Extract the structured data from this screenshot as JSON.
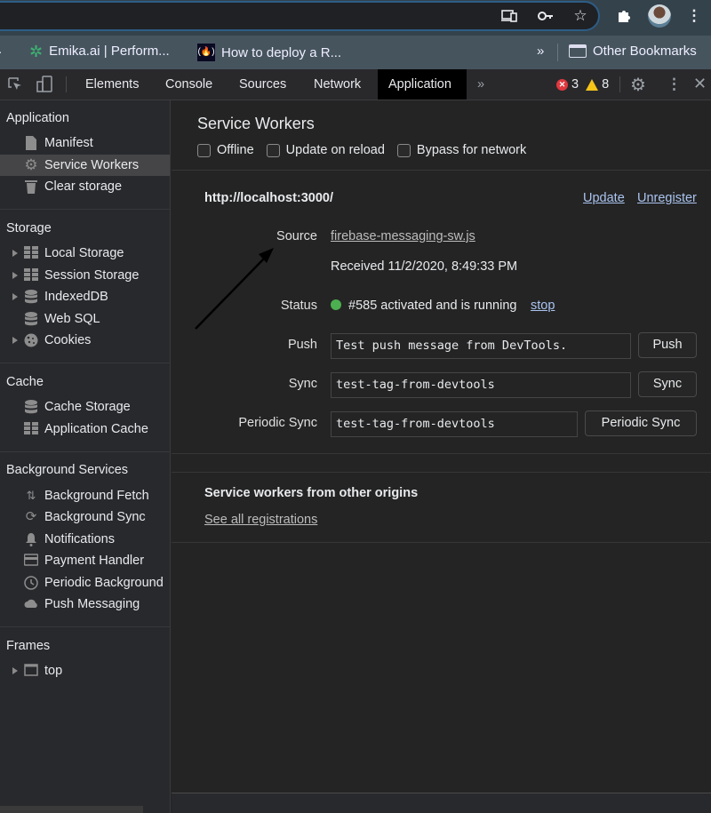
{
  "browser": {
    "toolbar_icons": [
      "cast-device-icon",
      "key-icon",
      "star-icon",
      "extensions-icon",
      "avatar",
      "more-icon"
    ],
    "bookmarks": [
      {
        "label": "Emika.ai | Perform...",
        "icon": "emika-logo-icon"
      },
      {
        "label": "How to deploy a R...",
        "icon": "freecodecamp-logo-icon"
      }
    ],
    "overflow_label": "»",
    "other_bookmarks": "Other Bookmarks"
  },
  "devtools": {
    "tabs": [
      "Elements",
      "Console",
      "Sources",
      "Network",
      "Application"
    ],
    "active_tab": "Application",
    "more_tabs": "»",
    "error_count": "3",
    "warning_count": "8",
    "colors": {
      "error": "#e0383e",
      "warning": "#f5c518",
      "status_ok": "#4caf50",
      "link": "#aac4ef"
    }
  },
  "sidebar": {
    "sections": [
      {
        "title": "Application",
        "items": [
          {
            "label": "Manifest",
            "icon": "file-icon",
            "expandable": false
          },
          {
            "label": "Service Workers",
            "icon": "gear-icon",
            "expandable": false,
            "selected": true
          },
          {
            "label": "Clear storage",
            "icon": "trash-icon",
            "expandable": false
          }
        ]
      },
      {
        "title": "Storage",
        "items": [
          {
            "label": "Local Storage",
            "icon": "grid-icon",
            "expandable": true
          },
          {
            "label": "Session Storage",
            "icon": "grid-icon",
            "expandable": true
          },
          {
            "label": "IndexedDB",
            "icon": "database-icon",
            "expandable": true
          },
          {
            "label": "Web SQL",
            "icon": "database-icon",
            "expandable": false
          },
          {
            "label": "Cookies",
            "icon": "cookie-icon",
            "expandable": true
          }
        ]
      },
      {
        "title": "Cache",
        "items": [
          {
            "label": "Cache Storage",
            "icon": "database-icon",
            "expandable": false
          },
          {
            "label": "Application Cache",
            "icon": "grid-icon",
            "expandable": false
          }
        ]
      },
      {
        "title": "Background Services",
        "items": [
          {
            "label": "Background Fetch",
            "icon": "arrows-updown-icon",
            "expandable": false
          },
          {
            "label": "Background Sync",
            "icon": "sync-icon",
            "expandable": false
          },
          {
            "label": "Notifications",
            "icon": "bell-icon",
            "expandable": false
          },
          {
            "label": "Payment Handler",
            "icon": "card-icon",
            "expandable": false
          },
          {
            "label": "Periodic Background",
            "icon": "clock-icon",
            "expandable": false
          },
          {
            "label": "Push Messaging",
            "icon": "cloud-icon",
            "expandable": false
          }
        ]
      },
      {
        "title": "Frames",
        "items": [
          {
            "label": "top",
            "icon": "frame-icon",
            "expandable": true
          }
        ]
      }
    ]
  },
  "main": {
    "title": "Service Workers",
    "checkboxes": [
      {
        "label": "Offline",
        "checked": false
      },
      {
        "label": "Update on reload",
        "checked": false
      },
      {
        "label": "Bypass for network",
        "checked": false
      }
    ],
    "origin": "http://localhost:3000/",
    "update_link": "Update",
    "unregister_link": "Unregister",
    "source_label": "Source",
    "source_file": "firebase-messaging-sw.js",
    "received": "Received 11/2/2020, 8:49:33 PM",
    "status_label": "Status",
    "status_text": "#585 activated and is running",
    "stop_link": "stop",
    "push_label": "Push",
    "push_value": "Test push message from DevTools.",
    "push_button": "Push",
    "sync_label": "Sync",
    "sync_value": "test-tag-from-devtools",
    "sync_button": "Sync",
    "periodic_label": "Periodic Sync",
    "periodic_value": "test-tag-from-devtools",
    "periodic_button": "Periodic Sync",
    "other_origins_title": "Service workers from other origins",
    "see_all_link": "See all registrations"
  }
}
